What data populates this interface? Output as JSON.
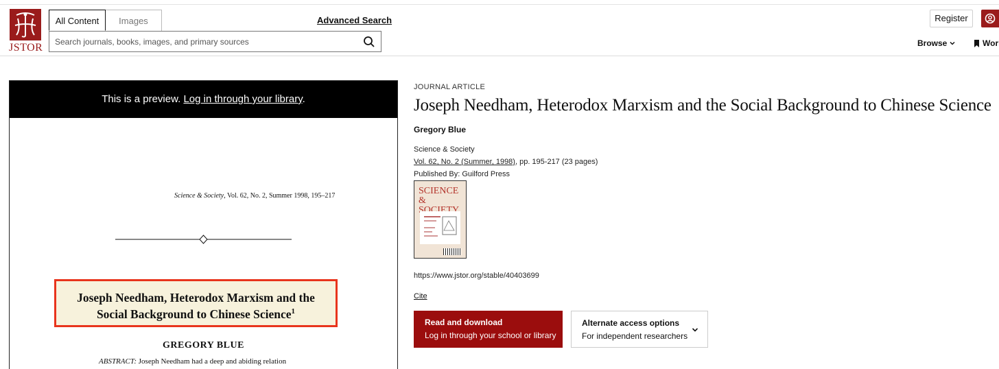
{
  "brand": {
    "logo_text": "JSTOR",
    "accent_color": "#9a1b1b"
  },
  "search": {
    "tabs": [
      "All Content",
      "Images"
    ],
    "active_tab": "All Content",
    "advanced_search_label": "Advanced Search",
    "placeholder": "Search journals, books, images, and primary sources"
  },
  "header": {
    "register_label": "Register",
    "browse_label": "Browse",
    "workspace_label": "Workspace"
  },
  "preview": {
    "bar_text": "This is a preview.",
    "bar_link": "Log in through your library",
    "bar_period": ".",
    "page": {
      "citation_journal": "Science & Society",
      "citation_rest": ", Vol. 62, No. 2, Summer 1998, 195–217",
      "title_line1": "Joseph Needham, Heterodox Marxism and the",
      "title_line2": "Social Background to Chinese Science",
      "title_footnote": "1",
      "author": "GREGORY BLUE",
      "abstract_label": "ABSTRACT:",
      "abstract_text": "Joseph Needham had a deep and abiding relation",
      "highlight_color": "#e8341c"
    }
  },
  "article": {
    "type": "JOURNAL ARTICLE",
    "title": "Joseph Needham, Heterodox Marxism and the Social Background to Chinese Science",
    "author": "Gregory Blue",
    "journal": "Science & Society",
    "volume_link": "Vol. 62, No. 2 (Summer, 1998)",
    "pages": ", pp. 195-217 (23 pages)",
    "publisher": "Published By: Guilford Press",
    "cover_title": "SCIENCE & SOCIETY",
    "stable_url": "https://www.jstor.org/stable/40403699",
    "cite_label": "Cite"
  },
  "actions": {
    "read": {
      "line1": "Read and download",
      "line2": "Log in through your school or library"
    },
    "alternate": {
      "line1": "Alternate access options",
      "line2": "For independent researchers"
    }
  }
}
